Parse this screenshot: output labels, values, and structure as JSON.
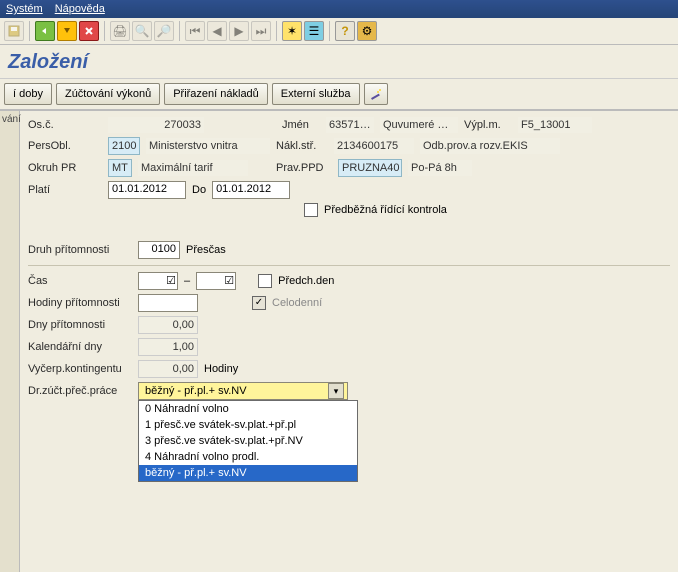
{
  "menu": {
    "system": "Systém",
    "help": "Nápověda"
  },
  "page_title": "Založení",
  "subtoolbar": {
    "time": "í doby",
    "zuct": "Zúčtování výkonů",
    "prir": "Přiřazení nákladů",
    "ext": "Externí služba"
  },
  "side": {
    "label": "vání"
  },
  "header": {
    "osc_lbl": "Os.č.",
    "osc_val": "270033",
    "jmen_lbl": "Jmén",
    "jmen_num": "63571…",
    "jmen_name": "Quvumeré …",
    "vypl_lbl": "Výpl.m.",
    "vypl_val": "F5_13001",
    "pers_lbl": "PersObl.",
    "pers_code": "2100",
    "pers_txt": "Ministerstvo vnitra",
    "nakl_lbl": "Nákl.stř.",
    "nakl_val": "2134600175",
    "nakl_txt": "Odb.prov.a rozv.EKIS",
    "okr_lbl": "Okruh PR",
    "okr_code": "MT",
    "okr_txt": "Maximální tarif",
    "prav_lbl": "Prav.PPD",
    "prav_val": "PRUZNA40",
    "prav_txt": "Po-Pá 8h",
    "plati_lbl": "Platí",
    "plati_from": "01.01.2012",
    "do_lbl": "Do",
    "plati_to": "01.01.2012",
    "predb": "Předběžná řídící kontrola"
  },
  "form": {
    "druh_lbl": "Druh přítomnosti",
    "druh_val": "0100",
    "druh_txt": "Přesčas",
    "cas_lbl": "Čas",
    "dash": "–",
    "predch": "Předch.den",
    "hod_lbl": "Hodiny přítomnosti",
    "celod": "Celodenní",
    "dny_lbl": "Dny přítomnosti",
    "dny_val": "0,00",
    "kal_lbl": "Kalendářní dny",
    "kal_val": "1,00",
    "vyc_lbl": "Vyčerp.kontingentu",
    "vyc_val": "0,00",
    "vyc_unit": "Hodiny",
    "dd_lbl": "Dr.zúčt.přeč.práce",
    "dd_selected": "běžný - př.pl.+ sv.NV",
    "dd_items": [
      "0 Náhradní volno",
      "1 přesč.ve svátek-sv.plat.+př.pl",
      "3 přesč.ve svátek-sv.plat.+př.NV",
      "4 Náhradní volno prodl.",
      "   běžný - př.pl.+ sv.NV"
    ],
    "dd_sel_index": 4
  }
}
